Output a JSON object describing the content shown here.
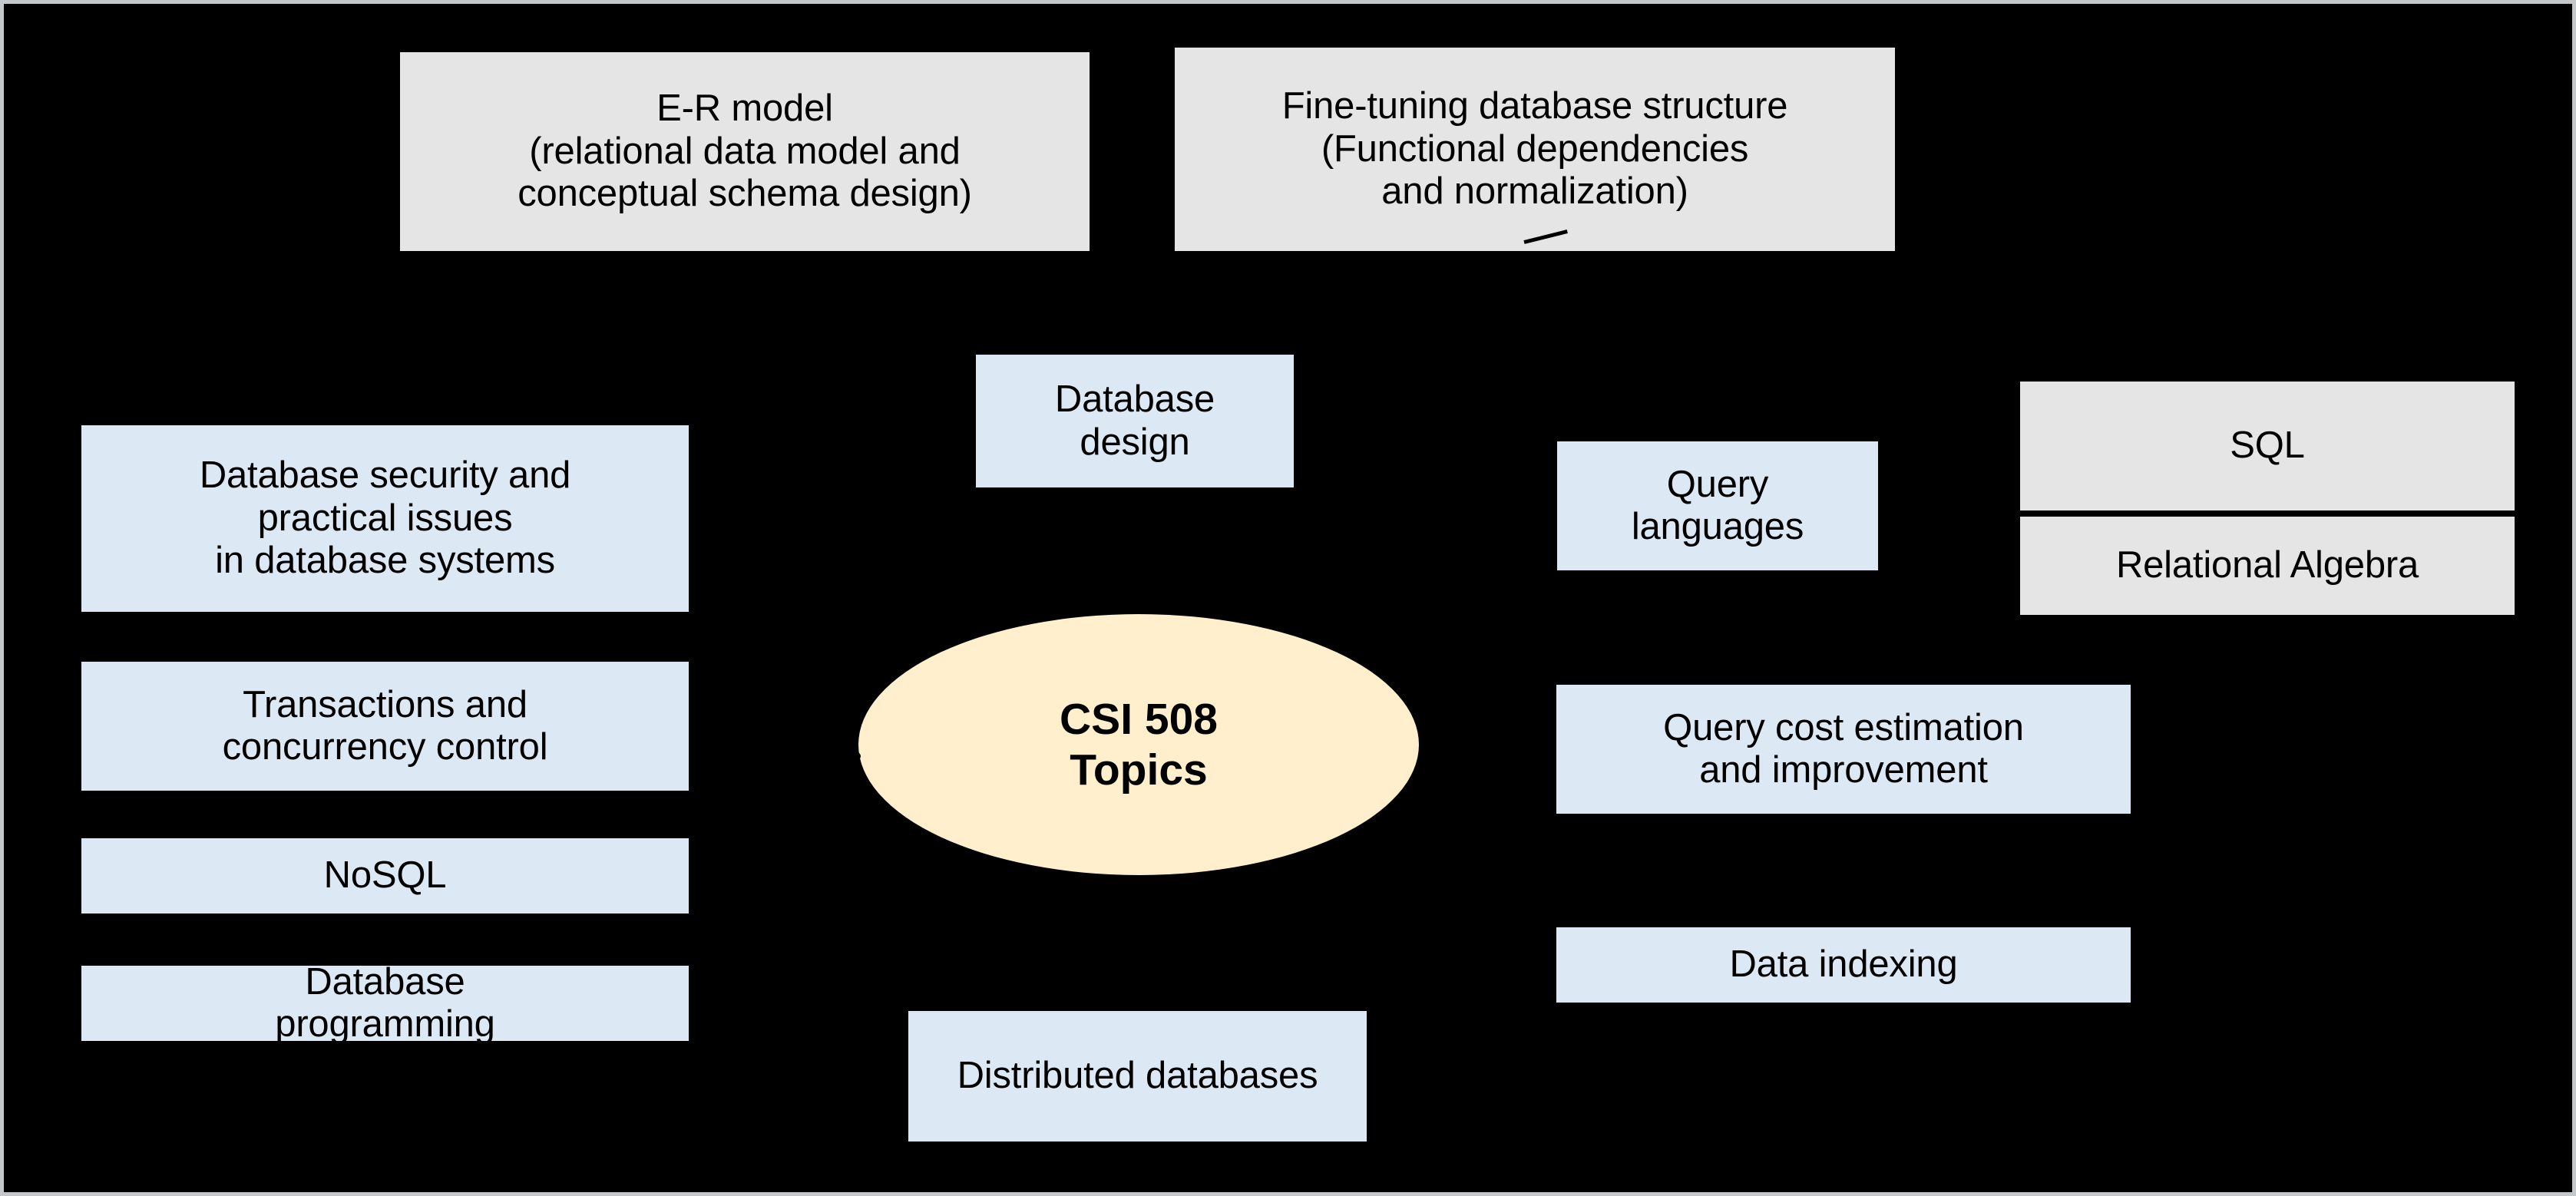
{
  "diagram": {
    "title": "CSI 508 Topics",
    "canvas_background": "#000000",
    "frame_border_color": "#C5C8CA",
    "palette": {
      "gray_box_fill": "#E5E5E5",
      "blue_box_fill": "#DDE8F5",
      "ellipse_fill": "#FFEFCC",
      "text_color": "#000000"
    },
    "center": {
      "label": "CSI 508\nTopics"
    },
    "nodes": [
      {
        "id": "er-model",
        "label": "E-R model\n(relational data model and\nconceptual schema design)",
        "style": "gray"
      },
      {
        "id": "fine-tuning",
        "label": "Fine-tuning database structure\n(Functional dependencies\nand normalization)",
        "style": "gray"
      },
      {
        "id": "database-design",
        "label": "Database\ndesign",
        "style": "blue"
      },
      {
        "id": "database-security",
        "label": "Database security and\npractical issues\nin database systems",
        "style": "blue"
      },
      {
        "id": "transactions",
        "label": "Transactions and\nconcurrency control",
        "style": "blue"
      },
      {
        "id": "distributed-databases",
        "label": "Distributed databases",
        "style": "blue"
      },
      {
        "id": "nosql",
        "label": "NoSQL",
        "style": "blue"
      },
      {
        "id": "database-programming",
        "label": "Database\nprogramming",
        "style": "blue"
      },
      {
        "id": "query-languages",
        "label": "Query\nlanguages",
        "style": "blue"
      },
      {
        "id": "query-cost",
        "label": "Query cost estimation\nand improvement",
        "style": "blue"
      },
      {
        "id": "data-indexing",
        "label": "Data indexing",
        "style": "blue"
      },
      {
        "id": "sql",
        "label": "SQL",
        "style": "gray"
      },
      {
        "id": "relational-algebra",
        "label": "Relational Algebra",
        "style": "gray"
      }
    ]
  }
}
